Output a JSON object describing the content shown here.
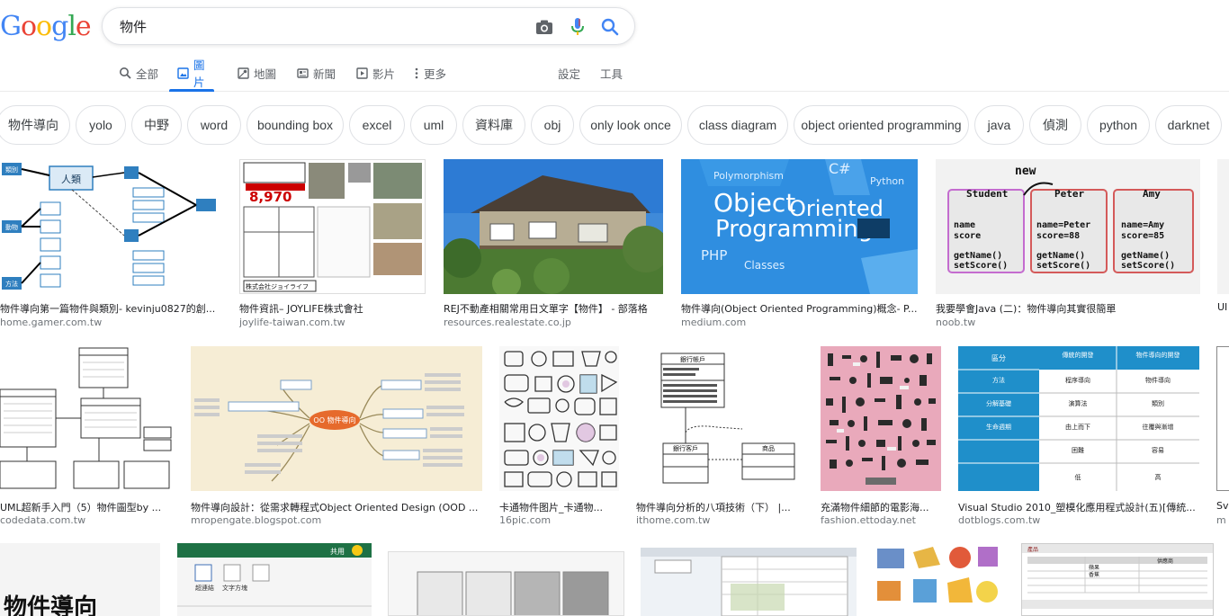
{
  "logo": {
    "letters": [
      "G",
      "o",
      "o",
      "g",
      "l",
      "e"
    ]
  },
  "search": {
    "query": "物件"
  },
  "tabs": [
    {
      "label": "全部",
      "icon": "search-icon"
    },
    {
      "label": "圖片",
      "icon": "image-icon"
    },
    {
      "label": "地圖",
      "icon": "map-icon"
    },
    {
      "label": "新聞",
      "icon": "news-icon"
    },
    {
      "label": "影片",
      "icon": "video-icon"
    },
    {
      "label": "更多",
      "icon": "more-vert-icon"
    }
  ],
  "tools": {
    "settings": "設定",
    "tools": "工具"
  },
  "chips": [
    "物件導向",
    "yolo",
    "中野",
    "word",
    "bounding box",
    "excel",
    "uml",
    "資料庫",
    "obj",
    "only look once",
    "class diagram",
    "object oriented programming",
    "java",
    "偵測",
    "python",
    "darknet"
  ],
  "results_row1": [
    {
      "title": "物件導向第一篇物件與類別- kevinju0827的創...",
      "source": "home.gamer.com.tw"
    },
    {
      "title": "物件資訊– JOYLIFE株式會社",
      "source": "joylife-taiwan.com.tw"
    },
    {
      "title": "REJ不動產相關常用日文單字【物件】 - 部落格",
      "source": "resources.realestate.co.jp"
    },
    {
      "title": "物件導向(Object Oriented Programming)概念- P...",
      "source": "medium.com"
    },
    {
      "title": "我要學會Java (二)：物件導向其實很簡單",
      "source": "noob.tw"
    },
    {
      "title": "UI",
      "source": ""
    }
  ],
  "results_row2": [
    {
      "title": "UML超新手入門（5）物件圖型by ...",
      "source": "codedata.com.tw"
    },
    {
      "title": "物件導向設計：從需求轉程式Object Oriented Design (OOD ...",
      "source": "mropengate.blogspot.com"
    },
    {
      "title": "卡通物件图片_卡通物...",
      "source": "16pic.com"
    },
    {
      "title": "物件導向分析的八項技術（下） |...",
      "source": "ithome.com.tw"
    },
    {
      "title": "充滿物件細節的電影海...",
      "source": "fashion.ettoday.net"
    },
    {
      "title": "Visual Studio 2010_塑模化應用程式設計(五)[傳統...",
      "source": "dotblogs.com.tw"
    },
    {
      "title": "Sv",
      "source": "m"
    }
  ],
  "thumb_text": {
    "oop_title_1": "Object",
    "oop_title_2": "Oriented",
    "oop_title_3": "Programming",
    "oop_tag_1": "Polymorphism",
    "oop_tag_2": "C#",
    "oop_tag_3": "Python",
    "oop_tag_4": "PHP",
    "oop_tag_5": "Classes",
    "java_new": "new",
    "java_cls1": "Student",
    "java_cls2": "Peter",
    "java_cls3": "Amy",
    "java_f1a": "name",
    "java_f1b": "score",
    "java_f2a": "name=Peter",
    "java_f2b": "score=88",
    "java_f3a": "name=Amy",
    "java_f3b": "score=85",
    "java_m1": "getName()",
    "java_m2": "setScore()",
    "jp_price": "8,970",
    "jp_company": "株式会社ジョイライフ",
    "uml_box1": "人類",
    "uml_box2": "類別",
    "uml_box3": "動物",
    "uml_box4": "方法",
    "vs_col1": "區分",
    "vs_col2": "傳統的開發",
    "vs_col3": "物件導向的開發",
    "vs_row1": "方法",
    "vs_row1a": "程序導向",
    "vs_row1b": "物件導向",
    "vs_row2": "分解基礎",
    "vs_row2a": "演算法",
    "vs_row2b": "類別",
    "vs_row3": "生命週期",
    "vs_row3a": "由上而下",
    "vs_row3b": "往覆與漸增",
    "vs_row4a": "困難",
    "vs_row4b": "容易",
    "vs_row5a": "低",
    "vs_row5b": "高",
    "ood_center": "OO 物件導向",
    "ith_class1": "銀行帳戶",
    "ith_class2": "銀行客戶",
    "ith_class3": "商品",
    "excel_share": "共用",
    "excel_label": "超連結",
    "excel_label2": "文字方塊",
    "bottom_text": "物件導向",
    "tbl_h1": "產品",
    "tbl_h2": "供應商",
    "tbl_r1": "蘋果",
    "tbl_r2": "香蕉"
  },
  "colors": {
    "accent": "#1a73e8",
    "chip_border": "#dfe1e5",
    "uml_blue": "#2f7fbf",
    "vs_blue": "#1f8fca"
  }
}
